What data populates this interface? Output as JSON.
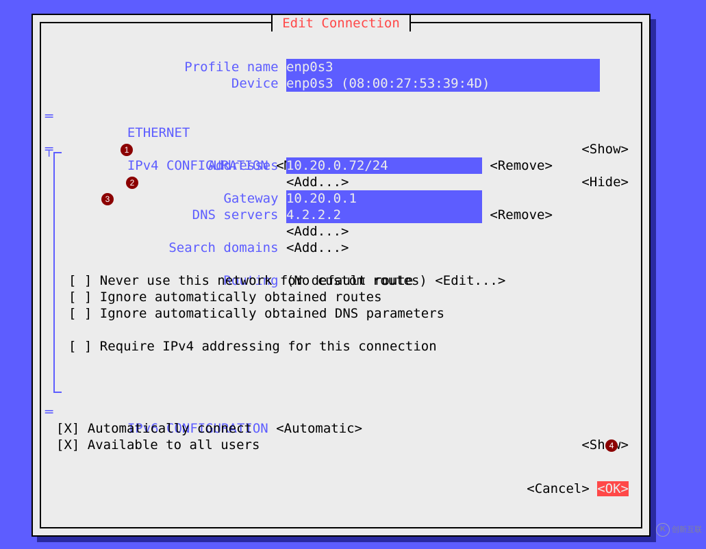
{
  "title": "Edit Connection",
  "profile": {
    "name_label": "Profile name",
    "name_value": "enp0s3                                  ",
    "device_label": "Device",
    "device_value": "enp0s3 (08:00:27:53:39:4D)              "
  },
  "ethernet": {
    "header": "ETHERNET",
    "toggle": "<Show>"
  },
  "ipv4": {
    "header": "IPv4 CONFIGURATION",
    "mode": "<Manual>",
    "toggle": "<Hide>",
    "addresses_label": "Addresses",
    "address_value": "10.20.0.72/24            ",
    "remove": "<Remove>",
    "add": "<Add...>",
    "gateway_label": "Gateway",
    "gateway_value": "10.20.0.1                ",
    "dns_label": "DNS servers",
    "dns_value": "4.2.2.2                  ",
    "search_label": "Search domains",
    "routing_label": "Routing",
    "routing_value": "(No custom routes)",
    "edit": "<Edit...>",
    "chk_never": "[ ] Never use this network for default route",
    "chk_ign_routes": "[ ] Ignore automatically obtained routes",
    "chk_ign_dns": "[ ] Ignore automatically obtained DNS parameters",
    "chk_require": "[ ] Require IPv4 addressing for this connection"
  },
  "ipv6": {
    "header": "IPv6 CONFIGURATION",
    "mode": "<Automatic>",
    "toggle": "<Show>"
  },
  "auto_connect": "[X] Automatically connect",
  "all_users": "[X] Available to all users",
  "cancel": "<Cancel>",
  "ok": "<OK>",
  "badges": {
    "b1": "1",
    "b2": "2",
    "b3": "3",
    "b4": "4"
  },
  "watermark": "创新互联"
}
